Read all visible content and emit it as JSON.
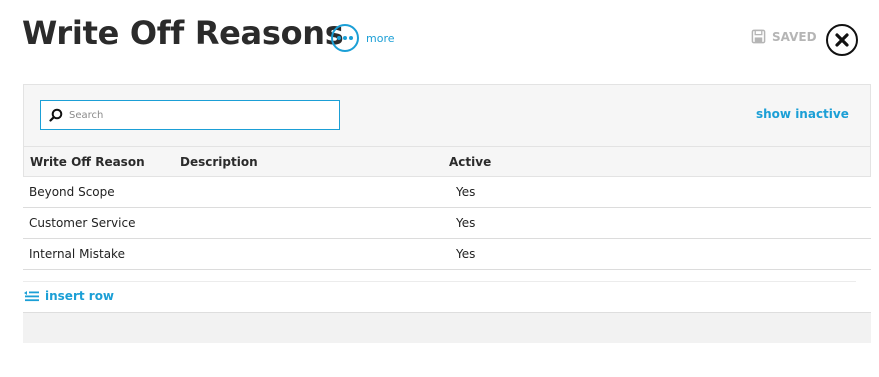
{
  "header": {
    "title": "Write Off Reasons",
    "more_label": "more",
    "saved_label": "SAVED"
  },
  "toolbar": {
    "search_placeholder": "Search",
    "show_inactive_label": "show inactive"
  },
  "table": {
    "columns": [
      "Write Off Reason",
      "Description",
      "Active"
    ],
    "rows": [
      {
        "reason": "Beyond Scope",
        "description": "",
        "active": "Yes"
      },
      {
        "reason": "Customer Service",
        "description": "",
        "active": "Yes"
      },
      {
        "reason": "Internal Mistake",
        "description": "",
        "active": "Yes"
      }
    ]
  },
  "footer": {
    "insert_row_label": "insert row"
  },
  "icons": {
    "more": "more-dots-icon",
    "saved": "floppy-disk-icon",
    "close": "close-icon",
    "search": "search-icon",
    "insert_row": "insert-row-icon"
  },
  "colors": {
    "accent": "#1b9fd6",
    "muted": "#b5b5b5",
    "panel_bg": "#f6f6f6"
  }
}
